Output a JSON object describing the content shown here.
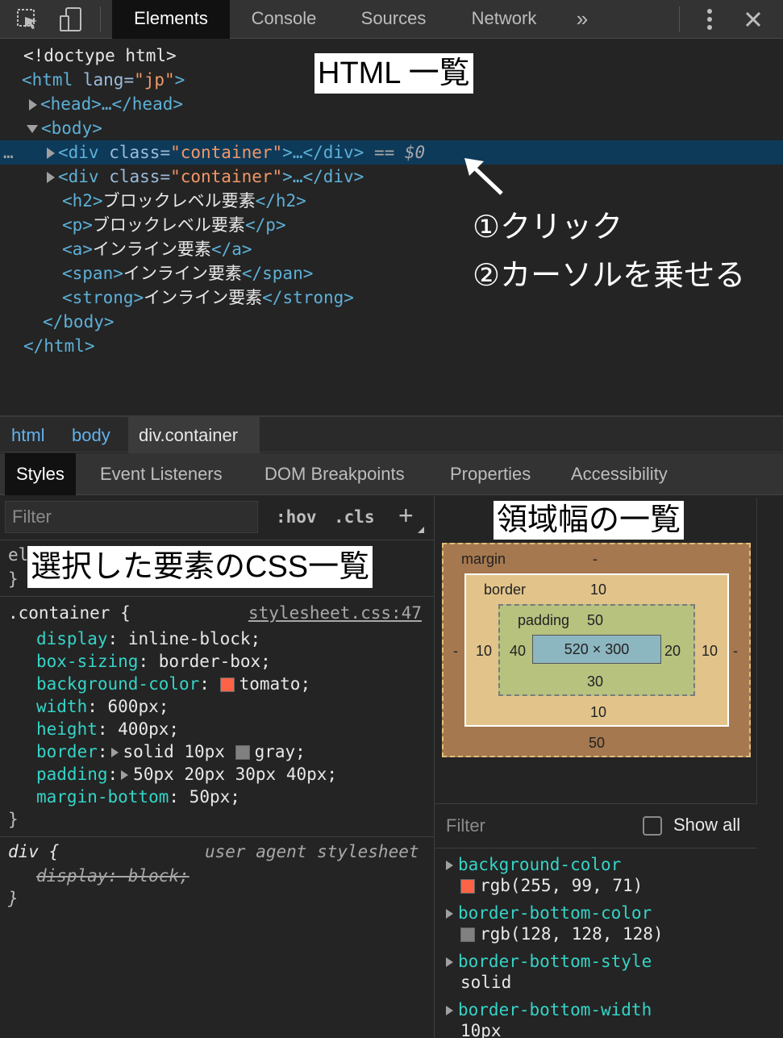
{
  "toolbar": {
    "tabs": [
      "Elements",
      "Console",
      "Sources",
      "Network"
    ],
    "more": "»"
  },
  "tree": {
    "doctype": "<!doctype html>",
    "html_open_tag": "<html",
    "lang_attr": "lang=",
    "lang_value": "\"jp\"",
    "html_open_end": ">",
    "head": "<head>…</head>",
    "body_open": "<body>",
    "div_open": "<div",
    "class_attr": "class=",
    "class_value": "\"container\"",
    "div_close_collapsed": ">…</div>",
    "selected_marker": "== $0",
    "row_dots": "…",
    "h2_open": "<h2>",
    "h2_text": "ブロックレベル要素",
    "h2_close": "</h2>",
    "p_open": "<p>",
    "p_text": "ブロックレベル要素",
    "p_close": "</p>",
    "a_open": "<a>",
    "a_text": "インライン要素",
    "a_close": "</a>",
    "span_open": "<span>",
    "span_text": "インライン要素",
    "span_close": "</span>",
    "strong_open": "<strong>",
    "strong_text": "インライン要素",
    "strong_close": "</strong>",
    "body_close": "</body>",
    "html_close": "</html>"
  },
  "annotations": {
    "html_list": "HTML 一覧",
    "step1": "①クリック",
    "step2": "②カーソルを乗せる",
    "box_list": "領域幅の一覧",
    "css_list": "選択した要素のCSS一覧"
  },
  "breadcrumbs": [
    "html",
    "body",
    "div.container"
  ],
  "subtabs": [
    "Styles",
    "Event Listeners",
    "DOM Breakpoints",
    "Properties",
    "Accessibility"
  ],
  "styles": {
    "filter_placeholder": "Filter",
    "hov": ":hov",
    "cls": ".cls",
    "plus": "+",
    "element_style_partial": "el",
    "brace_close": "}",
    "container_selector": ".container",
    "brace_open": "{",
    "source_link": "stylesheet.css:47",
    "properties": [
      {
        "name": "display",
        "value": "inline-block;"
      },
      {
        "name": "box-sizing",
        "value": "border-box;"
      },
      {
        "name": "background-color",
        "value": "tomato;",
        "swatch": "#ff6347"
      },
      {
        "name": "width",
        "value": "600px;"
      },
      {
        "name": "height",
        "value": "400px;"
      },
      {
        "name": "border",
        "value": "solid 10px ",
        "swatch": "#808080",
        "value2": "gray;",
        "expandable": true
      },
      {
        "name": "padding",
        "value": "50px 20px 30px 40px;",
        "expandable": true
      },
      {
        "name": "margin-bottom",
        "value": "50px;"
      }
    ],
    "ua_selector": "div",
    "ua_source": "user agent stylesheet",
    "ua_property": "display: block;"
  },
  "box_model": {
    "margin_label": "margin",
    "margin_top": "-",
    "margin_left": "-",
    "margin_right": "-",
    "margin_bottom": "50",
    "border_label": "border",
    "border_top": "10",
    "border_left": "10",
    "border_right": "10",
    "border_bottom": "10",
    "padding_label": "padding",
    "padding_top": "50",
    "padding_left": "40",
    "padding_right": "20",
    "padding_bottom": "30",
    "content": "520 × 300",
    "colors": {
      "margin": "#a5784f",
      "border": "#e2c48b",
      "padding": "#b7c27f",
      "content": "#8cb6c0"
    }
  },
  "computed": {
    "filter_placeholder": "Filter",
    "show_all": "Show all",
    "items": [
      {
        "name": "background-color",
        "value": "rgb(255, 99, 71)",
        "swatch": "#ff6347"
      },
      {
        "name": "border-bottom-color",
        "value": "rgb(128, 128, 128)",
        "swatch": "#808080"
      },
      {
        "name": "border-bottom-style",
        "value": "solid"
      },
      {
        "name": "border-bottom-width",
        "value": "10px"
      }
    ]
  }
}
